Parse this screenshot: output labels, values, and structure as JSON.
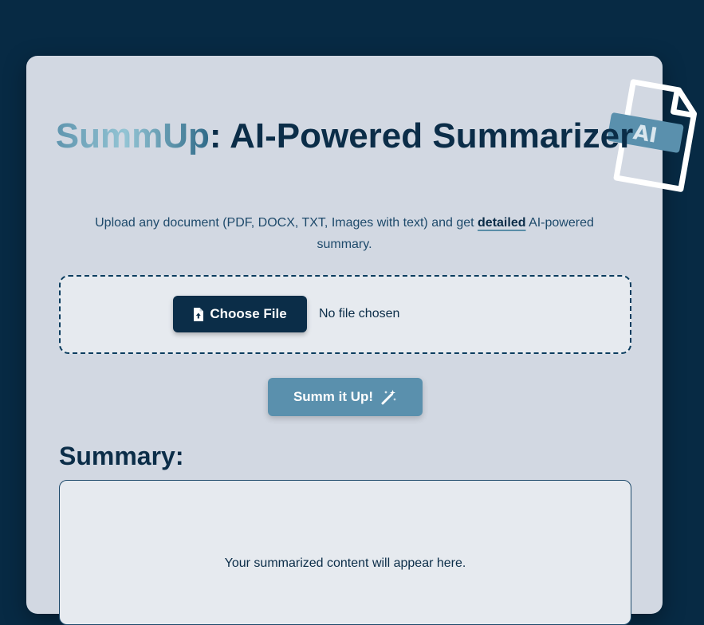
{
  "header": {
    "title_brand": "SummUp",
    "title_colon": ":",
    "title_rest": " AI-Powered Summarizer",
    "badge_text": "AI"
  },
  "description": {
    "before": "Upload any document (PDF, DOCX, TXT, Images with text) and get ",
    "emphasis": "detailed",
    "after": " AI-powered summary."
  },
  "upload": {
    "button_label": "Choose File",
    "status_text": "No file chosen"
  },
  "actions": {
    "summarize_label": "Summ it Up!"
  },
  "summary": {
    "heading": "Summary:",
    "placeholder": "Your summarized content will appear here."
  },
  "colors": {
    "page_background": "#072a44",
    "card_background": "#d2d8e2",
    "primary_dark": "#0b2d48",
    "accent": "#5a90ad"
  }
}
